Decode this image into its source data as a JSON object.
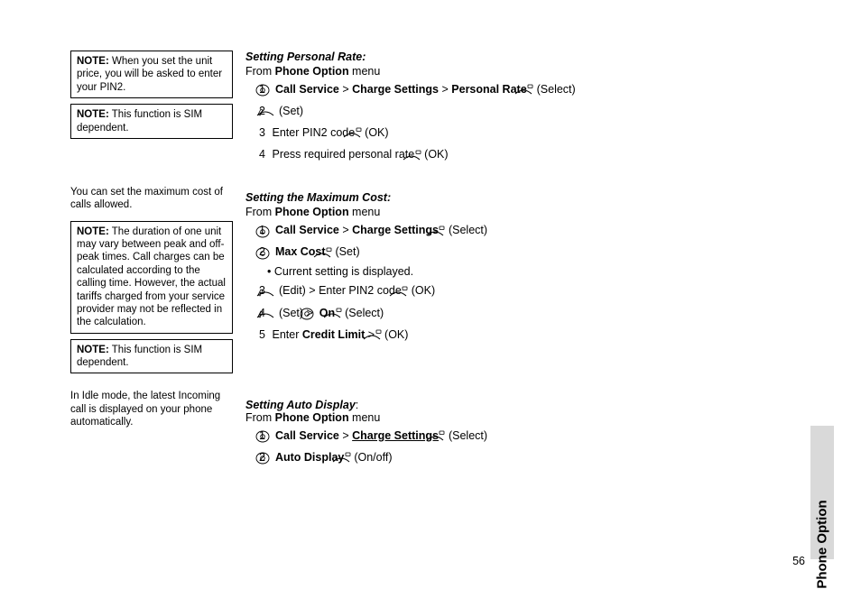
{
  "sidebar": {
    "note1": {
      "label": "NOTE:",
      "text": "When you set the unit price, you will be asked to enter your PIN2."
    },
    "note2": {
      "label": "NOTE:",
      "text": "This function is SIM dependent."
    },
    "para1": "You can set the maximum cost of calls allowed.",
    "note3": {
      "label": "NOTE:",
      "text": "The duration of one unit may vary between peak and off-peak times. Call charges can be calculated according to the calling time. However, the actual tariffs charged from your service provider may not be reflected in the calculation."
    },
    "note4": {
      "label": "NOTE:",
      "text": "This function is SIM dependent."
    },
    "para2": "In Idle mode, the latest Incoming call is displayed on your phone automatically."
  },
  "sections": {
    "personal": {
      "heading": "Setting Personal Rate:",
      "from_pre": "From ",
      "from_bold": "Phone Option",
      "from_post": " menu",
      "step1": {
        "n": "1",
        "b1": "Call Service",
        "b2": "Charge Settings",
        "b3": "Personal Rate",
        "gt": ">",
        "act_suffix": "(Select)"
      },
      "step2": {
        "n": "2",
        "act_suffix": "(Set)"
      },
      "step3": {
        "n": "3",
        "pre": "Enter PIN2 code ",
        "act_suffix": "(OK)"
      },
      "step4": {
        "n": "4",
        "pre": "Press required personal rate ",
        "act_suffix": "(OK)"
      }
    },
    "maxcost": {
      "heading": "Setting the Maximum Cost:",
      "from_pre": "From ",
      "from_bold": "Phone Option",
      "from_post": " menu",
      "step1": {
        "n": "1",
        "b1": "Call Service",
        "b2": "Charge Settings",
        "gt": ">",
        "act_suffix": "(Select)"
      },
      "step2": {
        "n": "2",
        "b1": "Max Cost",
        "act_suffix": "(Set)"
      },
      "sub": {
        "text": "• Current setting is displayed."
      },
      "step3": {
        "n": "3",
        "mid1": "(Edit) > Enter PIN2 code ",
        "act_suffix": "(OK)"
      },
      "step4": {
        "n": "4",
        "mid1": "(Set) > ",
        "b1": "On",
        "act_suffix": "(Select)"
      },
      "step5": {
        "n": "5",
        "pre": "Enter ",
        "b1": "Credit Limit",
        "post": " > ",
        "act_suffix": "(OK)"
      }
    },
    "autodisp": {
      "heading": "Setting Auto Display",
      "colon": ":",
      "from_pre": "From ",
      "from_bold": "Phone Option",
      "from_post": " menu",
      "step1": {
        "n": "1",
        "b1": "Call Service",
        "b2_u": "Charge Settings",
        "gt": ">",
        "act_suffix": "(Select)"
      },
      "step2": {
        "n": "2",
        "b1": "Auto Display",
        "act_suffix": "(On/off)"
      }
    }
  },
  "tab": "Phone Option",
  "page_number": "56"
}
